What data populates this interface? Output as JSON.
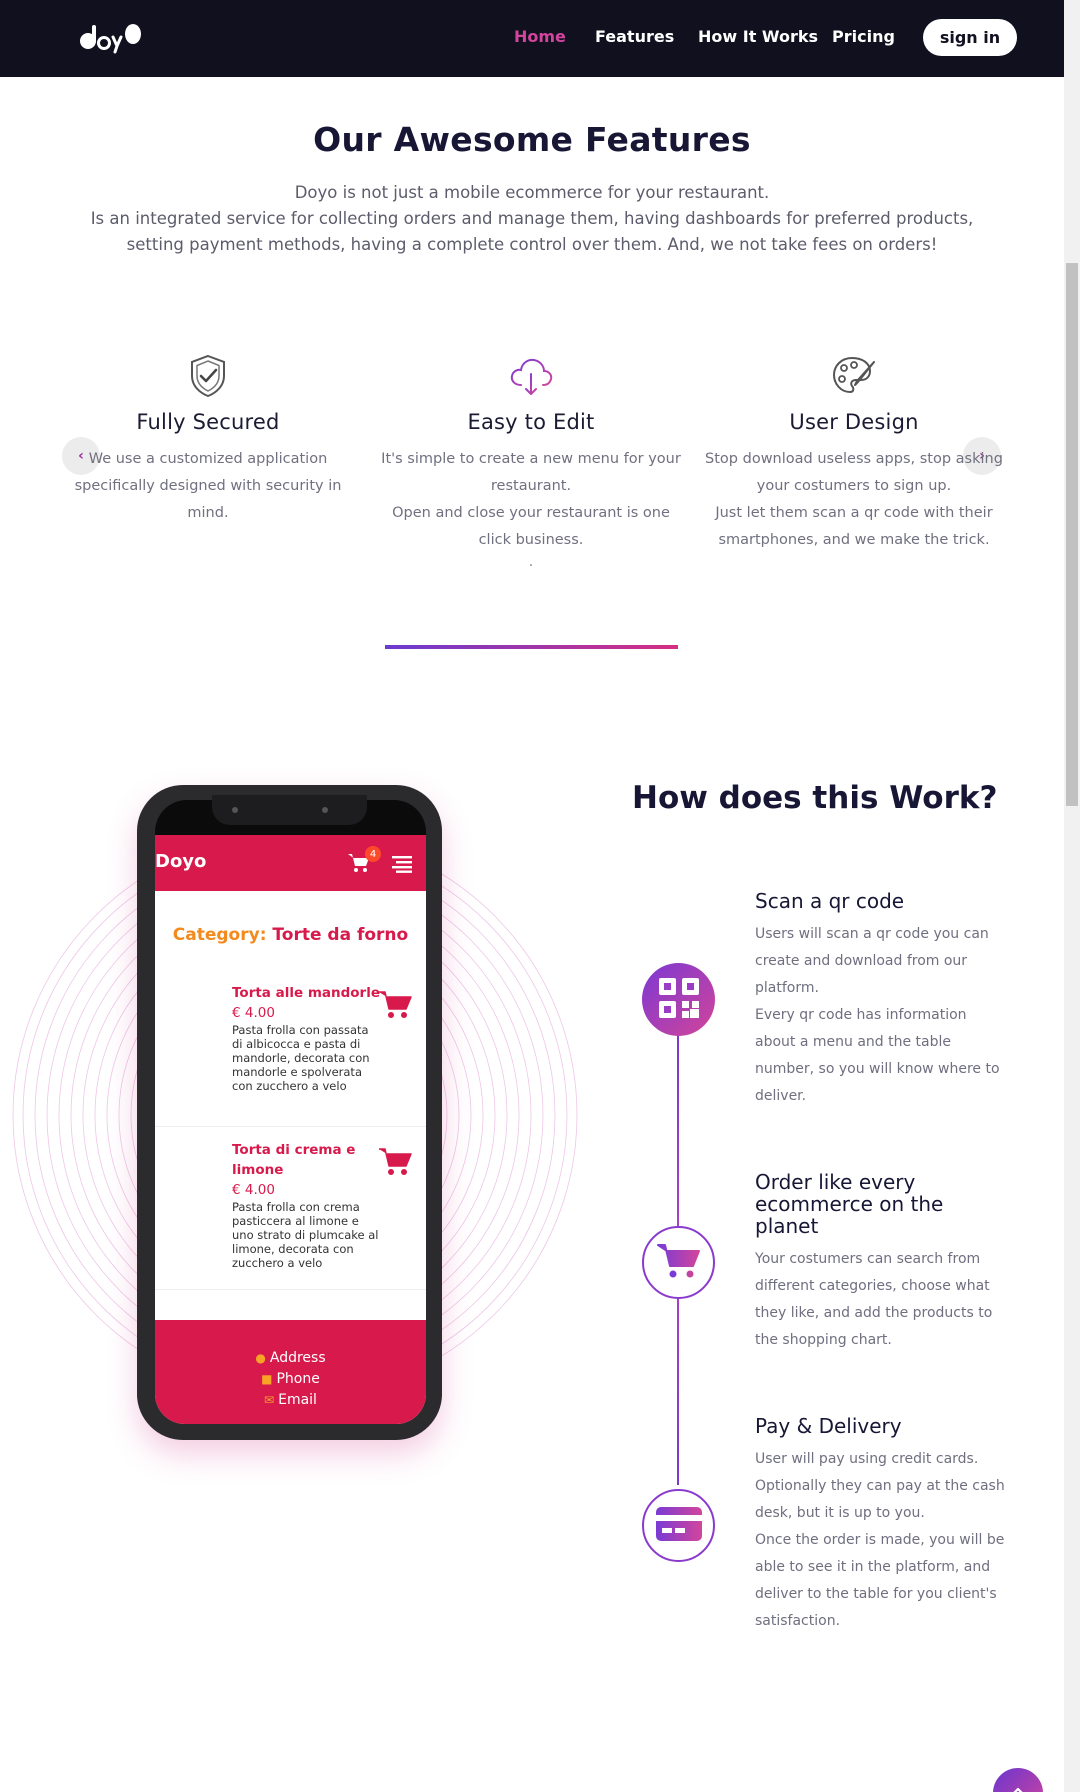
{
  "nav": {
    "logo_text": "doyo",
    "links": [
      "Home",
      "Features",
      "How It Works",
      "Pricing"
    ],
    "active": "Home",
    "signin_label": "sign in"
  },
  "features": {
    "title": "Our Awesome Features",
    "description_line1": "Doyo is not just a mobile ecommerce for your restaurant.",
    "description_line2": "Is an integrated service for collecting orders and manage them, having dashboards for preferred products, setting payment methods, having a complete control over them. And, we not take fees on orders!",
    "items": [
      {
        "icon": "shield-check-icon",
        "title": "Fully Secured",
        "text": "We use a customized application specifically designed with security in mind."
      },
      {
        "icon": "cloud-download-icon",
        "title": "Easy to Edit",
        "text": "It's simple to create a new menu for your restaurant.",
        "text2": "Open and close your restaurant is one click business.",
        "text3": "."
      },
      {
        "icon": "palette-icon",
        "title": "User Design",
        "text": "Stop download useless apps, stop asking your costumers to sign up.",
        "text2": "Just let them scan a qr code with their smartphones, and we make the trick."
      }
    ],
    "prev_label": "‹",
    "next_label": "›"
  },
  "phone": {
    "brand": "Doyo",
    "cart_count": "4",
    "category_label": "Category:",
    "category_value": "Torte da forno",
    "products": [
      {
        "name": "Torta alle mandorle",
        "price": "€ 4.00",
        "desc": "Pasta frolla con passata di albicocca e pasta di mandorle, decorata con mandorle e spolverata con zucchero a velo"
      },
      {
        "name": "Torta di crema e limone",
        "price": "€ 4.00",
        "desc": "Pasta frolla con crema pasticcera al limone e uno strato di plumcake al limone, decorata con zucchero a velo"
      }
    ],
    "footer": {
      "address": "Address",
      "phone": "Phone",
      "email": "Email"
    }
  },
  "how": {
    "title": "How does this Work?",
    "steps": [
      {
        "icon": "qr-code-icon",
        "title": "Scan a qr code",
        "text": "Users will scan a qr code you can create and download from our platform.",
        "text2": "Every qr code has information about a menu and the table number, so you will know where to deliver."
      },
      {
        "icon": "shopping-cart-icon",
        "title": "Order like every ecommerce on the planet",
        "text": "Your costumers can search from different categories, choose what they like, and add the products to the shopping chart."
      },
      {
        "icon": "credit-card-icon",
        "title": "Pay & Delivery",
        "text": "User will pay using credit cards. Optionally they can pay at the cash desk, but it is up to you.",
        "text2": "Once the order is made, you will be able to see it in the platform, and deliver to the table for you client's satisfaction."
      }
    ]
  },
  "colors": {
    "nav_bg": "#10101f",
    "accent_pink": "#d2459c",
    "accent_purple": "#6b3bd0",
    "app_red": "#d71a4b",
    "title_dark": "#171735"
  }
}
